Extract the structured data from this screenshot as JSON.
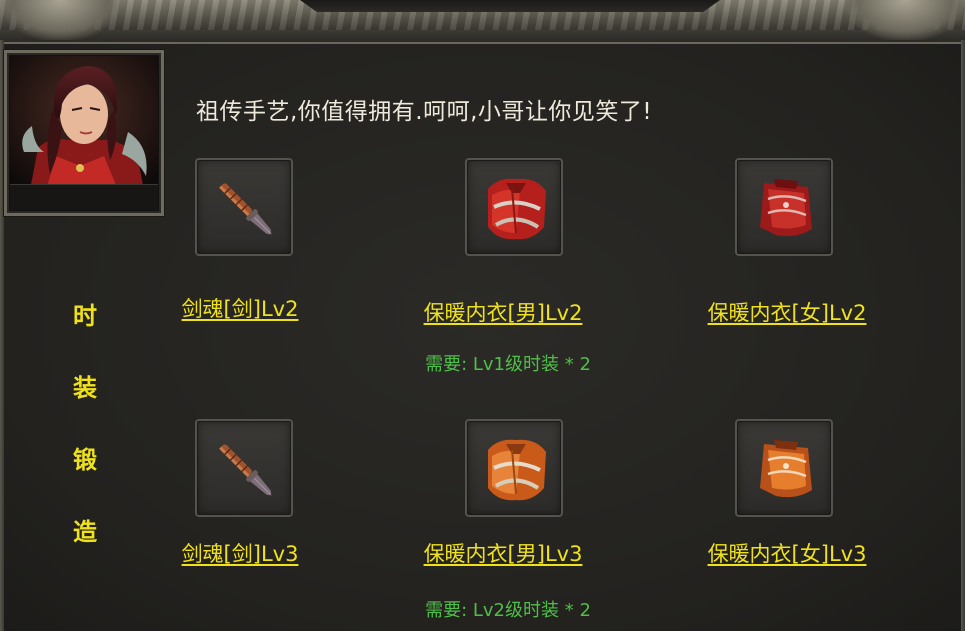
{
  "npc": {
    "dialog": "祖传手艺,你值得拥有.呵呵,小哥让你见笑了!"
  },
  "title_chars": [
    "时",
    "装",
    "锻",
    "造"
  ],
  "rows": [
    {
      "items": [
        {
          "name": "剑魂[剑]Lv2",
          "icon": "sword-icon"
        },
        {
          "name": "保暖内衣[男]Lv2",
          "icon": "male-underwear-red-icon"
        },
        {
          "name": "保暖内衣[女]Lv2",
          "icon": "female-underwear-red-icon"
        }
      ],
      "requirement": "需要: Lv1级时装 * 2"
    },
    {
      "items": [
        {
          "name": "剑魂[剑]Lv3",
          "icon": "sword-icon"
        },
        {
          "name": "保暖内衣[男]Lv3",
          "icon": "male-underwear-orange-icon"
        },
        {
          "name": "保暖内衣[女]Lv3",
          "icon": "female-underwear-orange-icon"
        }
      ],
      "requirement": "需要: Lv2级时装 * 2"
    }
  ],
  "colors": {
    "title": "#f0e21a",
    "item_link": "#f0e21a",
    "requirement": "#4fbf49",
    "dialog_text": "#efe9dc"
  }
}
